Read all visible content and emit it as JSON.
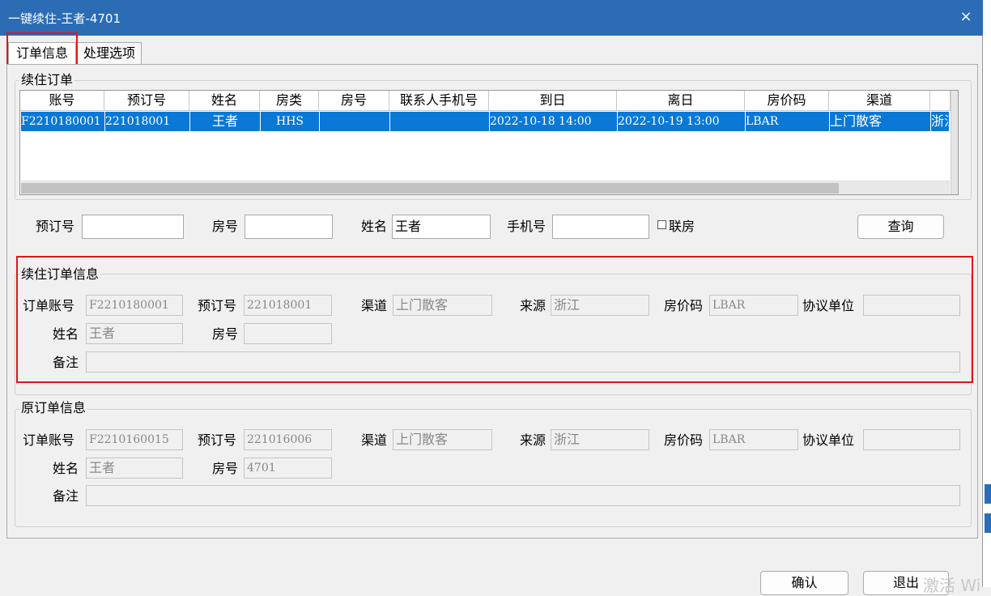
{
  "window": {
    "title": "一键续住-王者-4701",
    "close": "×"
  },
  "tabs": [
    {
      "label": "订单信息",
      "active": true
    },
    {
      "label": "处理选项",
      "active": false
    }
  ],
  "continue_orders": {
    "legend": "续住订单",
    "columns": [
      "账号",
      "预订号",
      "姓名",
      "房类",
      "房号",
      "联系人手机号",
      "到日",
      "离日",
      "房价码",
      "渠道"
    ],
    "rows": [
      [
        "F2210180001",
        "221018001",
        "王者",
        "HHS",
        "",
        "",
        "2022-10-18 14:00",
        "2022-10-19 13:00",
        "LBAR",
        "上门散客",
        "浙江"
      ]
    ]
  },
  "search": {
    "booking_no_label": "预订号",
    "booking_no_value": "",
    "room_label": "房号",
    "room_value": "",
    "name_label": "姓名",
    "name_value": "王者",
    "phone_label": "手机号",
    "phone_value": "",
    "linked_label": "联房",
    "query_button": "查询"
  },
  "continue_info": {
    "legend": "续住订单信息",
    "account_label": "订单账号",
    "account_value": "F2210180001",
    "booking_label": "预订号",
    "booking_value": "221018001",
    "channel_label": "渠道",
    "channel_value": "上门散客",
    "source_label": "来源",
    "source_value": "浙江",
    "rate_label": "房价码",
    "rate_value": "LBAR",
    "agreement_label": "协议单位",
    "agreement_value": "",
    "name_label": "姓名",
    "name_value": "王者",
    "room_label": "房号",
    "room_value": "",
    "remark_label": "备注",
    "remark_value": ""
  },
  "original_info": {
    "legend": "原订单信息",
    "account_label": "订单账号",
    "account_value": "F2210160015",
    "booking_label": "预订号",
    "booking_value": "221016006",
    "channel_label": "渠道",
    "channel_value": "上门散客",
    "source_label": "来源",
    "source_value": "浙江",
    "rate_label": "房价码",
    "rate_value": "LBAR",
    "agreement_label": "协议单位",
    "agreement_value": "",
    "name_label": "姓名",
    "name_value": "王者",
    "room_label": "房号",
    "room_value": "4701",
    "remark_label": "备注",
    "remark_value": ""
  },
  "footer": {
    "confirm": "确认",
    "exit": "退出"
  },
  "watermark": "激活 Wi",
  "colors": {
    "titlebar": "#2b6cb5",
    "selection": "#0a78d7",
    "highlight_box": "#e0161b"
  }
}
